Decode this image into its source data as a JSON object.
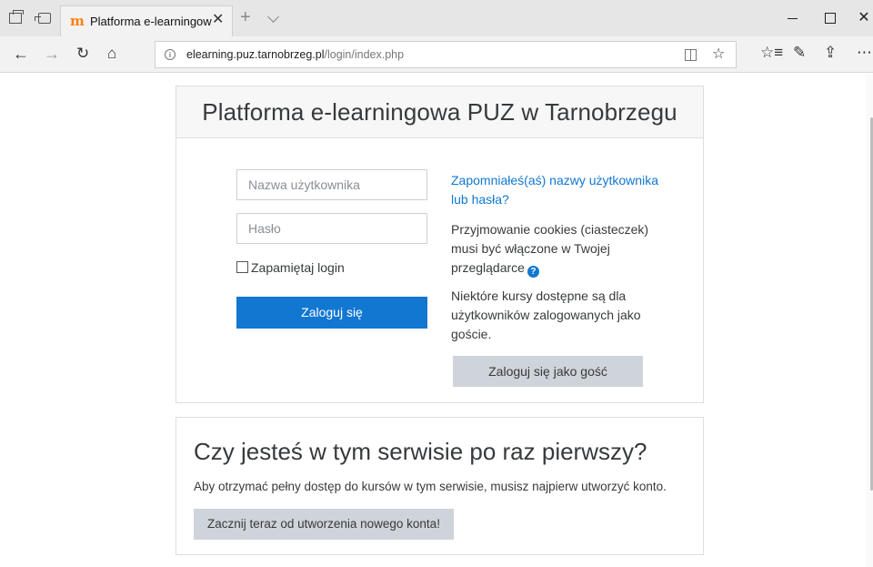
{
  "browser": {
    "tab_title": "Platforma e-learningow",
    "tab_favicon": "m",
    "tab_close": "✕",
    "new_tab": "+",
    "url_host": "elearning.puz.tarnobrzeg.pl",
    "url_path": "/login/index.php",
    "icons": {
      "back": "←",
      "forward": "→",
      "refresh": "↻",
      "home": "⌂",
      "info": "i",
      "favorite": "☆",
      "favorites_bar": "☆≡",
      "pen": "✎",
      "share": "⇪",
      "more": "⋯",
      "close": "✕"
    }
  },
  "login": {
    "site_title": "Platforma e-learningowa PUZ w Tarnobrzegu",
    "username_placeholder": "Nazwa użytkownika",
    "password_placeholder": "Hasło",
    "remember_label": "Zapamiętaj login",
    "login_button": "Zaloguj się",
    "forgot_link": "Zapomniałeś(aś) nazwy użytkownika lub hasła?",
    "cookies_text": "Przyjmowanie cookies (ciasteczek) musi być włączone w Twojej przeglądarce",
    "help_icon": "?",
    "guest_text": "Niektóre kursy dostępne są dla użytkowników zalogowanych jako goście.",
    "guest_button": "Zaloguj się jako gość"
  },
  "signup": {
    "title": "Czy jesteś w tym serwisie po raz pierwszy?",
    "description": "Aby otrzymać pełny dostęp do kursów w tym serwisie, musisz najpierw utworzyć konto.",
    "button": "Zacznij teraz od utworzenia nowego konta!"
  },
  "colors": {
    "primary": "#1177d1",
    "secondary_button": "#ced4da",
    "text": "#373a3c",
    "moodle_orange": "#f98012"
  }
}
